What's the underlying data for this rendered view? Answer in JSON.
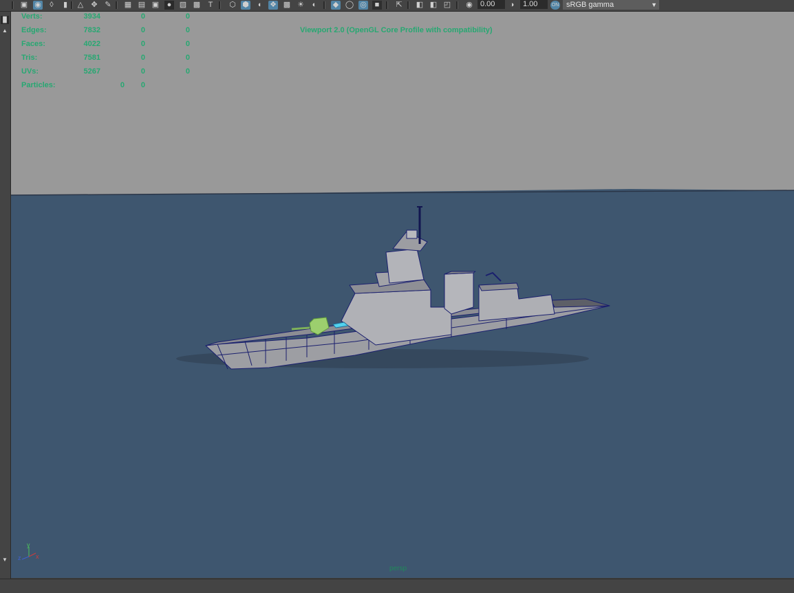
{
  "toolbar": {
    "exposure_value": "0.00",
    "gamma_value": "1.00",
    "color_space": "sRGB gamma",
    "icons": [
      "camera-select-icon",
      "camera-attributes-icon",
      "bookmark-icon",
      "image-plane-icon",
      "grease-pencil-icon",
      "2d-pan-icon",
      "grid-icon",
      "film-gate-icon",
      "resolution-gate-icon",
      "gate-mask-icon",
      "field-chart-icon",
      "safe-action-icon",
      "safe-title-icon",
      "wireframe-icon",
      "smooth-shade-icon",
      "wireframe-on-shaded-icon",
      "textured-icon",
      "use-all-lights-icon",
      "shadows-icon",
      "screen-space-ao-icon",
      "motion-blur-icon",
      "anti-alias-icon",
      "depth-of-field-icon",
      "isolate-select-icon",
      "xray-icon",
      "xray-joints-icon",
      "xray-active-icon",
      "exposure-icon",
      "gamma-icon",
      "color-management-icon"
    ]
  },
  "hud": {
    "stats": [
      {
        "label": "Verts:",
        "v1": "3934",
        "v2": "0",
        "v3": "0"
      },
      {
        "label": "Edges:",
        "v1": "7832",
        "v2": "0",
        "v3": "0"
      },
      {
        "label": "Faces:",
        "v1": "4022",
        "v2": "0",
        "v3": "0"
      },
      {
        "label": "Tris:",
        "v1": "7581",
        "v2": "0",
        "v3": "0"
      },
      {
        "label": "UVs:",
        "v1": "5267",
        "v2": "0",
        "v3": "0"
      }
    ],
    "particles": {
      "label": "Particles:",
      "v1": "0",
      "v2": "0"
    },
    "renderer": "Viewport 2.0 (OpenGL Core Profile with compatibility)",
    "camera": "persp",
    "axis_labels": {
      "y": "y",
      "z": "z",
      "x": "x"
    }
  },
  "colors": {
    "background_sky": "#999999",
    "ocean": "#3e566f",
    "hud_text": "#27a872",
    "ship_hull": "#a9a9ad",
    "wireframe": "#1a1f6e",
    "gun_selected": "#9ccf6e"
  }
}
